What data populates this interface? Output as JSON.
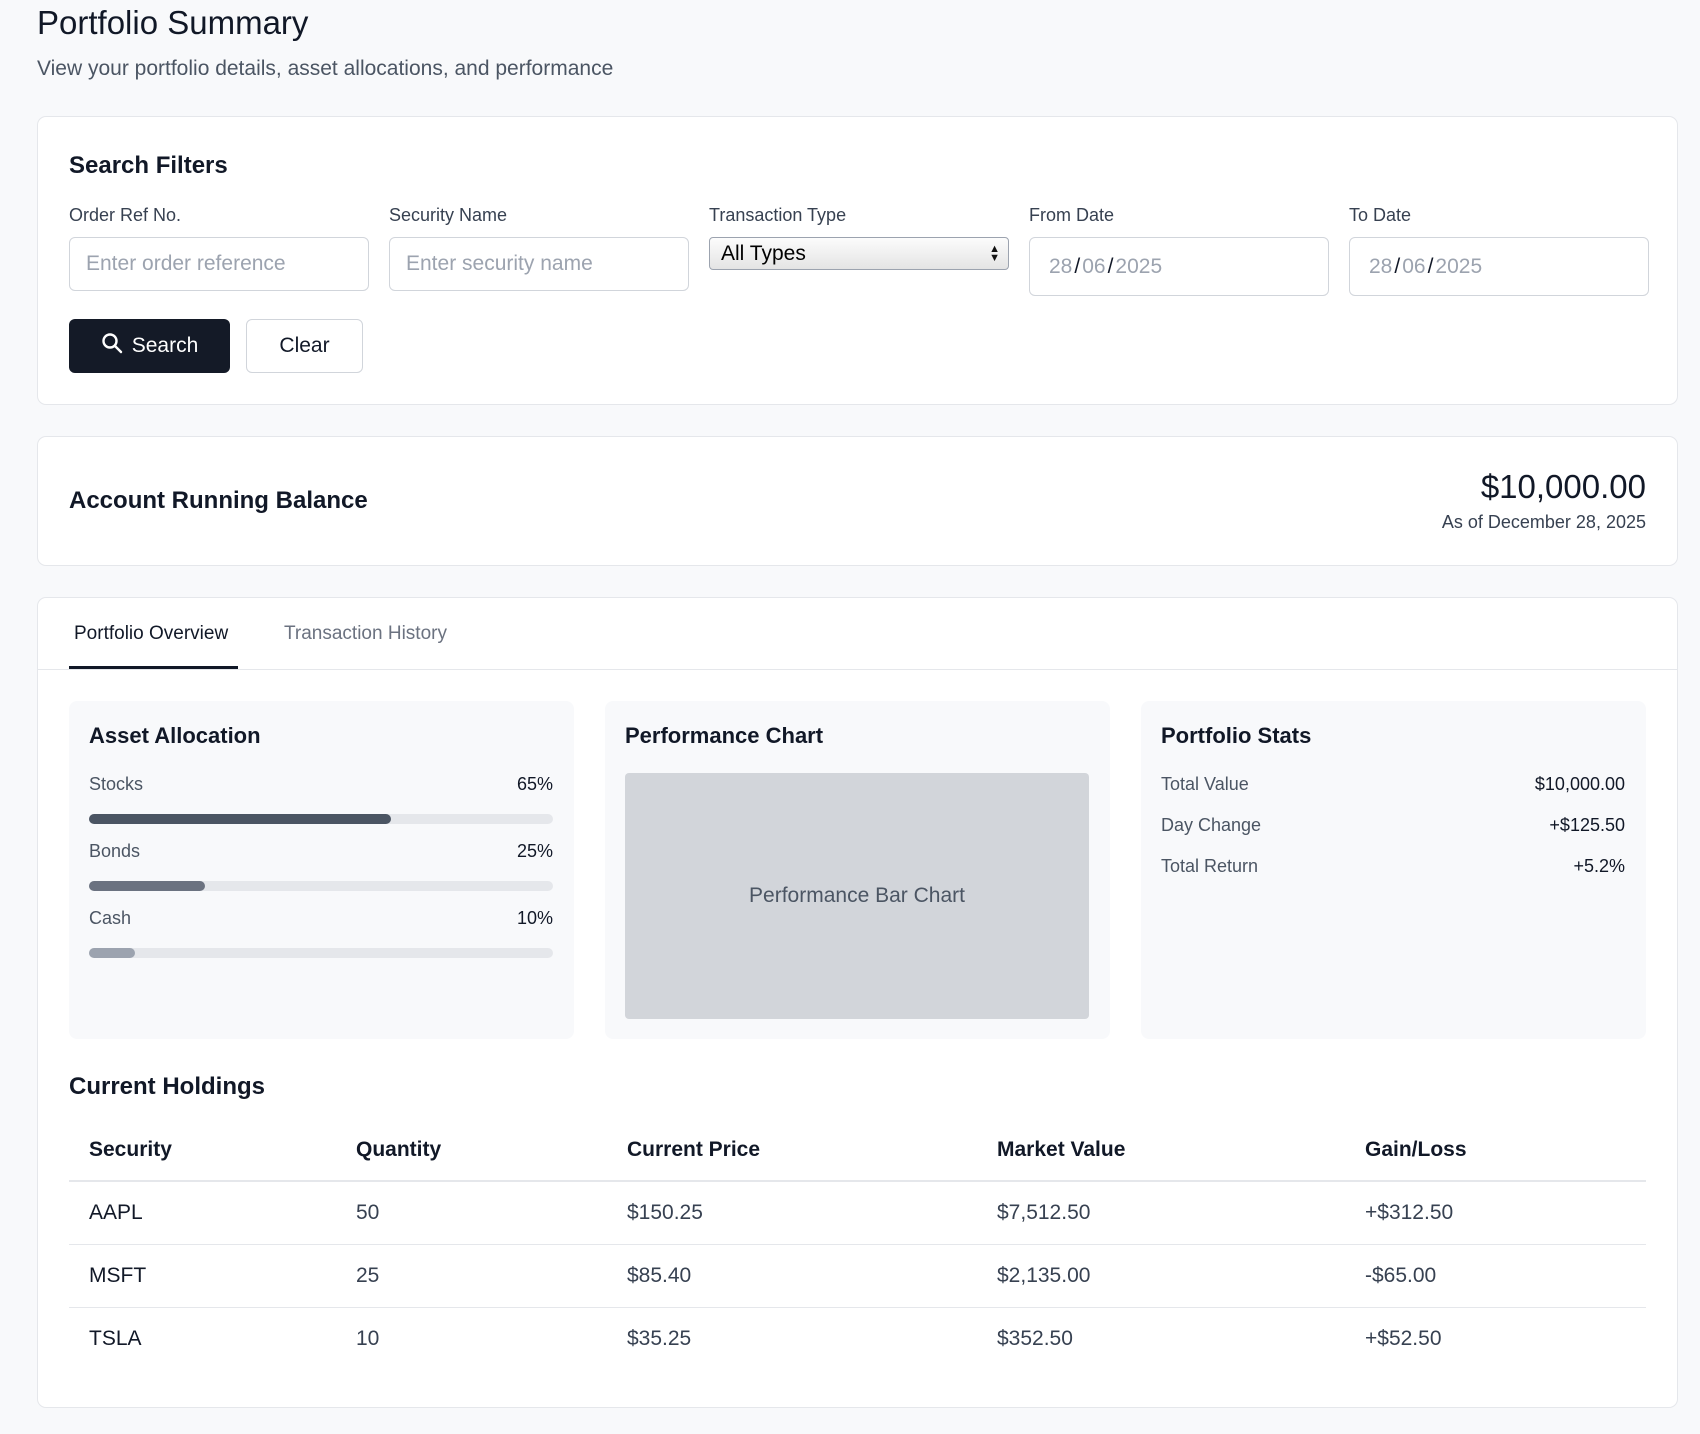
{
  "page": {
    "title": "Portfolio Summary",
    "subtitle": "View your portfolio details, asset allocations, and performance"
  },
  "filters": {
    "title": "Search Filters",
    "order_ref": {
      "label": "Order Ref No.",
      "placeholder": "Enter order reference",
      "value": ""
    },
    "security_name": {
      "label": "Security Name",
      "placeholder": "Enter security name",
      "value": ""
    },
    "transaction_type": {
      "label": "Transaction Type",
      "selected": "All Types"
    },
    "from_date": {
      "label": "From Date",
      "day": "28",
      "month": "06",
      "year": "2025"
    },
    "to_date": {
      "label": "To Date",
      "day": "28",
      "month": "06",
      "year": "2025"
    },
    "search_label": "Search",
    "clear_label": "Clear",
    "search_icon": "search-icon"
  },
  "balance": {
    "label": "Account Running Balance",
    "amount": "$10,000.00",
    "as_of": "As of December 28, 2025"
  },
  "tabs": [
    {
      "label": "Portfolio Overview",
      "active": true
    },
    {
      "label": "Transaction History",
      "active": false
    }
  ],
  "allocation": {
    "title": "Asset Allocation",
    "items": [
      {
        "name": "Stocks",
        "percent_label": "65%",
        "percent": 65,
        "color": "#4b5563"
      },
      {
        "name": "Bonds",
        "percent_label": "25%",
        "percent": 25,
        "color": "#6b7280"
      },
      {
        "name": "Cash",
        "percent_label": "10%",
        "percent": 10,
        "color": "#9ca3af"
      }
    ]
  },
  "performance": {
    "title": "Performance Chart",
    "placeholder": "Performance Bar Chart"
  },
  "stats": {
    "title": "Portfolio Stats",
    "items": [
      {
        "label": "Total Value",
        "value": "$10,000.00"
      },
      {
        "label": "Day Change",
        "value": "+$125.50"
      },
      {
        "label": "Total Return",
        "value": "+5.2%"
      }
    ]
  },
  "holdings": {
    "title": "Current Holdings",
    "columns": [
      "Security",
      "Quantity",
      "Current Price",
      "Market Value",
      "Gain/Loss"
    ],
    "rows": [
      [
        "AAPL",
        "50",
        "$150.25",
        "$7,512.50",
        "+$312.50"
      ],
      [
        "MSFT",
        "25",
        "$85.40",
        "$2,135.00",
        "-$65.00"
      ],
      [
        "TSLA",
        "10",
        "$35.25",
        "$352.50",
        "+$52.50"
      ]
    ]
  },
  "colors": {
    "primary_button": "#141a27",
    "background": "#f8f9fb"
  }
}
